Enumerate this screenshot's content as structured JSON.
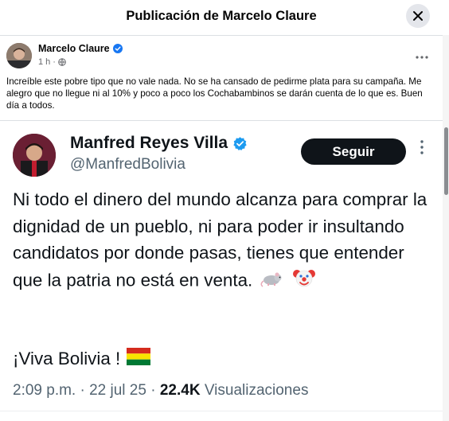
{
  "modal": {
    "title": "Publicación de Marcelo Claure"
  },
  "post": {
    "author": "Marcelo Claure",
    "time": "1 h",
    "dot": "·",
    "text": "Increíble este pobre tipo que no vale nada.  No se ha cansado de pedirme plata para su campaña.  Me alegro que no llegue ni al 10% y poco a poco los Cochabambinos se darán cuenta de lo que es. Buen día a todos."
  },
  "tweet": {
    "name": "Manfred Reyes Villa",
    "handle": "@ManfredBolivia",
    "follow_label": "Seguir",
    "body": "Ni todo el dinero del mundo alcanza para comprar la dignidad de un pueblo, ni para poder ir insultando candidatos por donde pasas, tienes que entender que la patria no está en venta.",
    "viva": "¡Viva Bolivia !",
    "time": "2:09 p.m.",
    "date": "22 jul 25",
    "views_count": "22.4K",
    "views_label": "Visualizaciones",
    "sep": "·"
  },
  "icons": {
    "close": "close-icon",
    "verified": "verified-badge-icon",
    "globe": "globe-icon",
    "more": "more-horizontal-icon",
    "more_vertical": "more-vertical-icon",
    "rat": "rat-emoji",
    "clown": "clown-emoji",
    "flag": "bolivia-flag-emoji"
  },
  "colors": {
    "verified_fb": "#1877f2",
    "verified_x": "#1d9bf0",
    "follow_bg": "#0f1419"
  }
}
